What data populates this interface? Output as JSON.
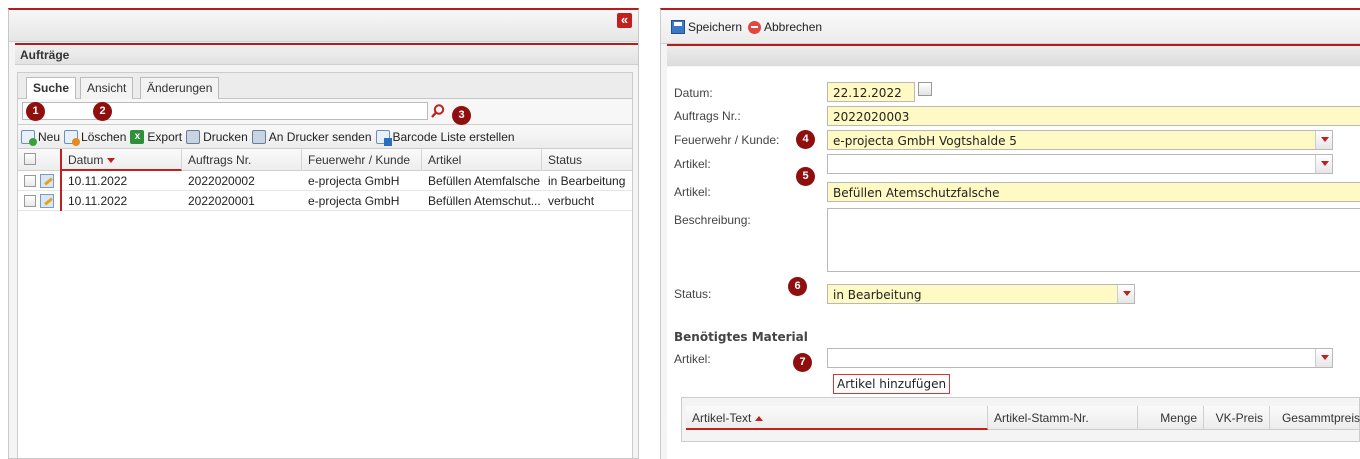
{
  "left": {
    "collapse_icon": "«",
    "title": "Aufträge",
    "tabs": [
      {
        "label": "Suche",
        "active": true
      },
      {
        "label": "Ansicht",
        "active": false
      },
      {
        "label": "Änderungen",
        "active": false
      }
    ],
    "search": {
      "value": "",
      "placeholder": ""
    },
    "toolbar": {
      "new": "Neu",
      "delete": "Löschen",
      "export": "Export",
      "print": "Drucken",
      "send_printer": "An Drucker senden",
      "barcode": "Barcode Liste erstellen"
    },
    "columns": [
      "Datum",
      "Auftrags Nr.",
      "Feuerwehr / Kunde",
      "Artikel",
      "Status"
    ],
    "rows": [
      {
        "date": "10.11.2022",
        "number": "2022020002",
        "customer": "e-projecta GmbH",
        "article": "Befüllen Atemfalsche",
        "status": "in Bearbeitung"
      },
      {
        "date": "10.11.2022",
        "number": "2022020001",
        "customer": "e-projecta GmbH",
        "article": "Befüllen Atemschut...",
        "status": "verbucht"
      }
    ]
  },
  "badges": [
    "1",
    "2",
    "3",
    "4",
    "5",
    "6",
    "7"
  ],
  "right": {
    "toolbar": {
      "save": "Speichern",
      "cancel": "Abbrechen"
    },
    "form": {
      "date_label": "Datum:",
      "date_value": "22.12.2022",
      "order_label": "Auftrags Nr.:",
      "order_value": "2022020003",
      "customer_label": "Feuerwehr / Kunde:",
      "customer_value": "e-projecta GmbH Vogtshalde 5",
      "article_select_label": "Artikel:",
      "article_select_value": "",
      "article_label": "Artikel:",
      "article_value": "Befüllen Atemschutzfalsche",
      "description_label": "Beschreibung:",
      "description_value": "",
      "status_label": "Status:",
      "status_value": "in Bearbeitung",
      "material_title": "Benötigtes Material",
      "material_article_label": "Artikel:",
      "material_article_value": "",
      "add_article_button": "Artikel hinzufügen"
    },
    "material_columns": [
      "Artikel-Text",
      "Artikel-Stamm-Nr.",
      "Menge",
      "VK-Preis",
      "Gesammtpreis"
    ]
  },
  "colors": {
    "accent": "#b61c1c",
    "badge": "#8f0e0e",
    "required_field": "#fff9c4"
  }
}
